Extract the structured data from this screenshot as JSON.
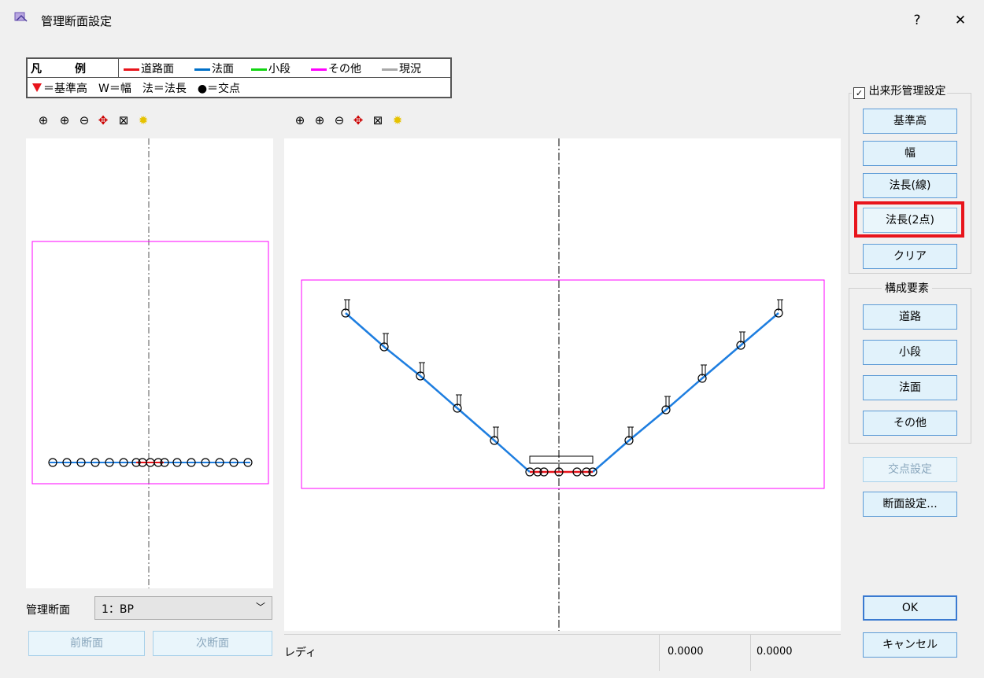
{
  "window": {
    "title": "管理断面設定",
    "help": "?",
    "close": "✕"
  },
  "legend": {
    "label_kanji1": "凡",
    "label_kanji2": "例",
    "items": [
      {
        "label": "道路面",
        "color": "#e8141b"
      },
      {
        "label": "法面",
        "color": "#0070c8"
      },
      {
        "label": "小段",
        "color": "#11d511"
      },
      {
        "label": "その他",
        "color": "#ff00ff"
      },
      {
        "label": "現況",
        "color": "#a8a8a8"
      }
    ],
    "symbols": "＝基準高　W＝幅　法＝法長　●＝交点",
    "triangle_color": "#e8141b"
  },
  "toolbar_icons": [
    "zoom-fit-icon",
    "zoom-in-icon",
    "zoom-out-icon",
    "pan-icon",
    "zoom-window-icon",
    "bulb-icon"
  ],
  "right_panel": {
    "checkbox_label": "出来形管理設定",
    "checkbox_checked": true,
    "buttons": [
      "基準高",
      "幅",
      "法長(線)",
      "法長(2点)",
      "クリア"
    ],
    "group2_title": "構成要素",
    "group2_buttons": [
      "道路",
      "小段",
      "法面",
      "その他"
    ],
    "intersection_button": "交点設定",
    "section_settings_button": "断面設定...",
    "ok": "OK",
    "cancel": "キャンセル"
  },
  "bottom_left": {
    "label": "管理断面",
    "select_value": "1：BP",
    "prev": "前断面",
    "next": "次断面"
  },
  "status": {
    "text": "レディ",
    "x": "0.0000",
    "y": "0.0000"
  },
  "colors": {
    "highlight": "#e8141b",
    "slope": "#1e7ee0",
    "road": "#e8141b",
    "frame": "#ff00ff"
  }
}
